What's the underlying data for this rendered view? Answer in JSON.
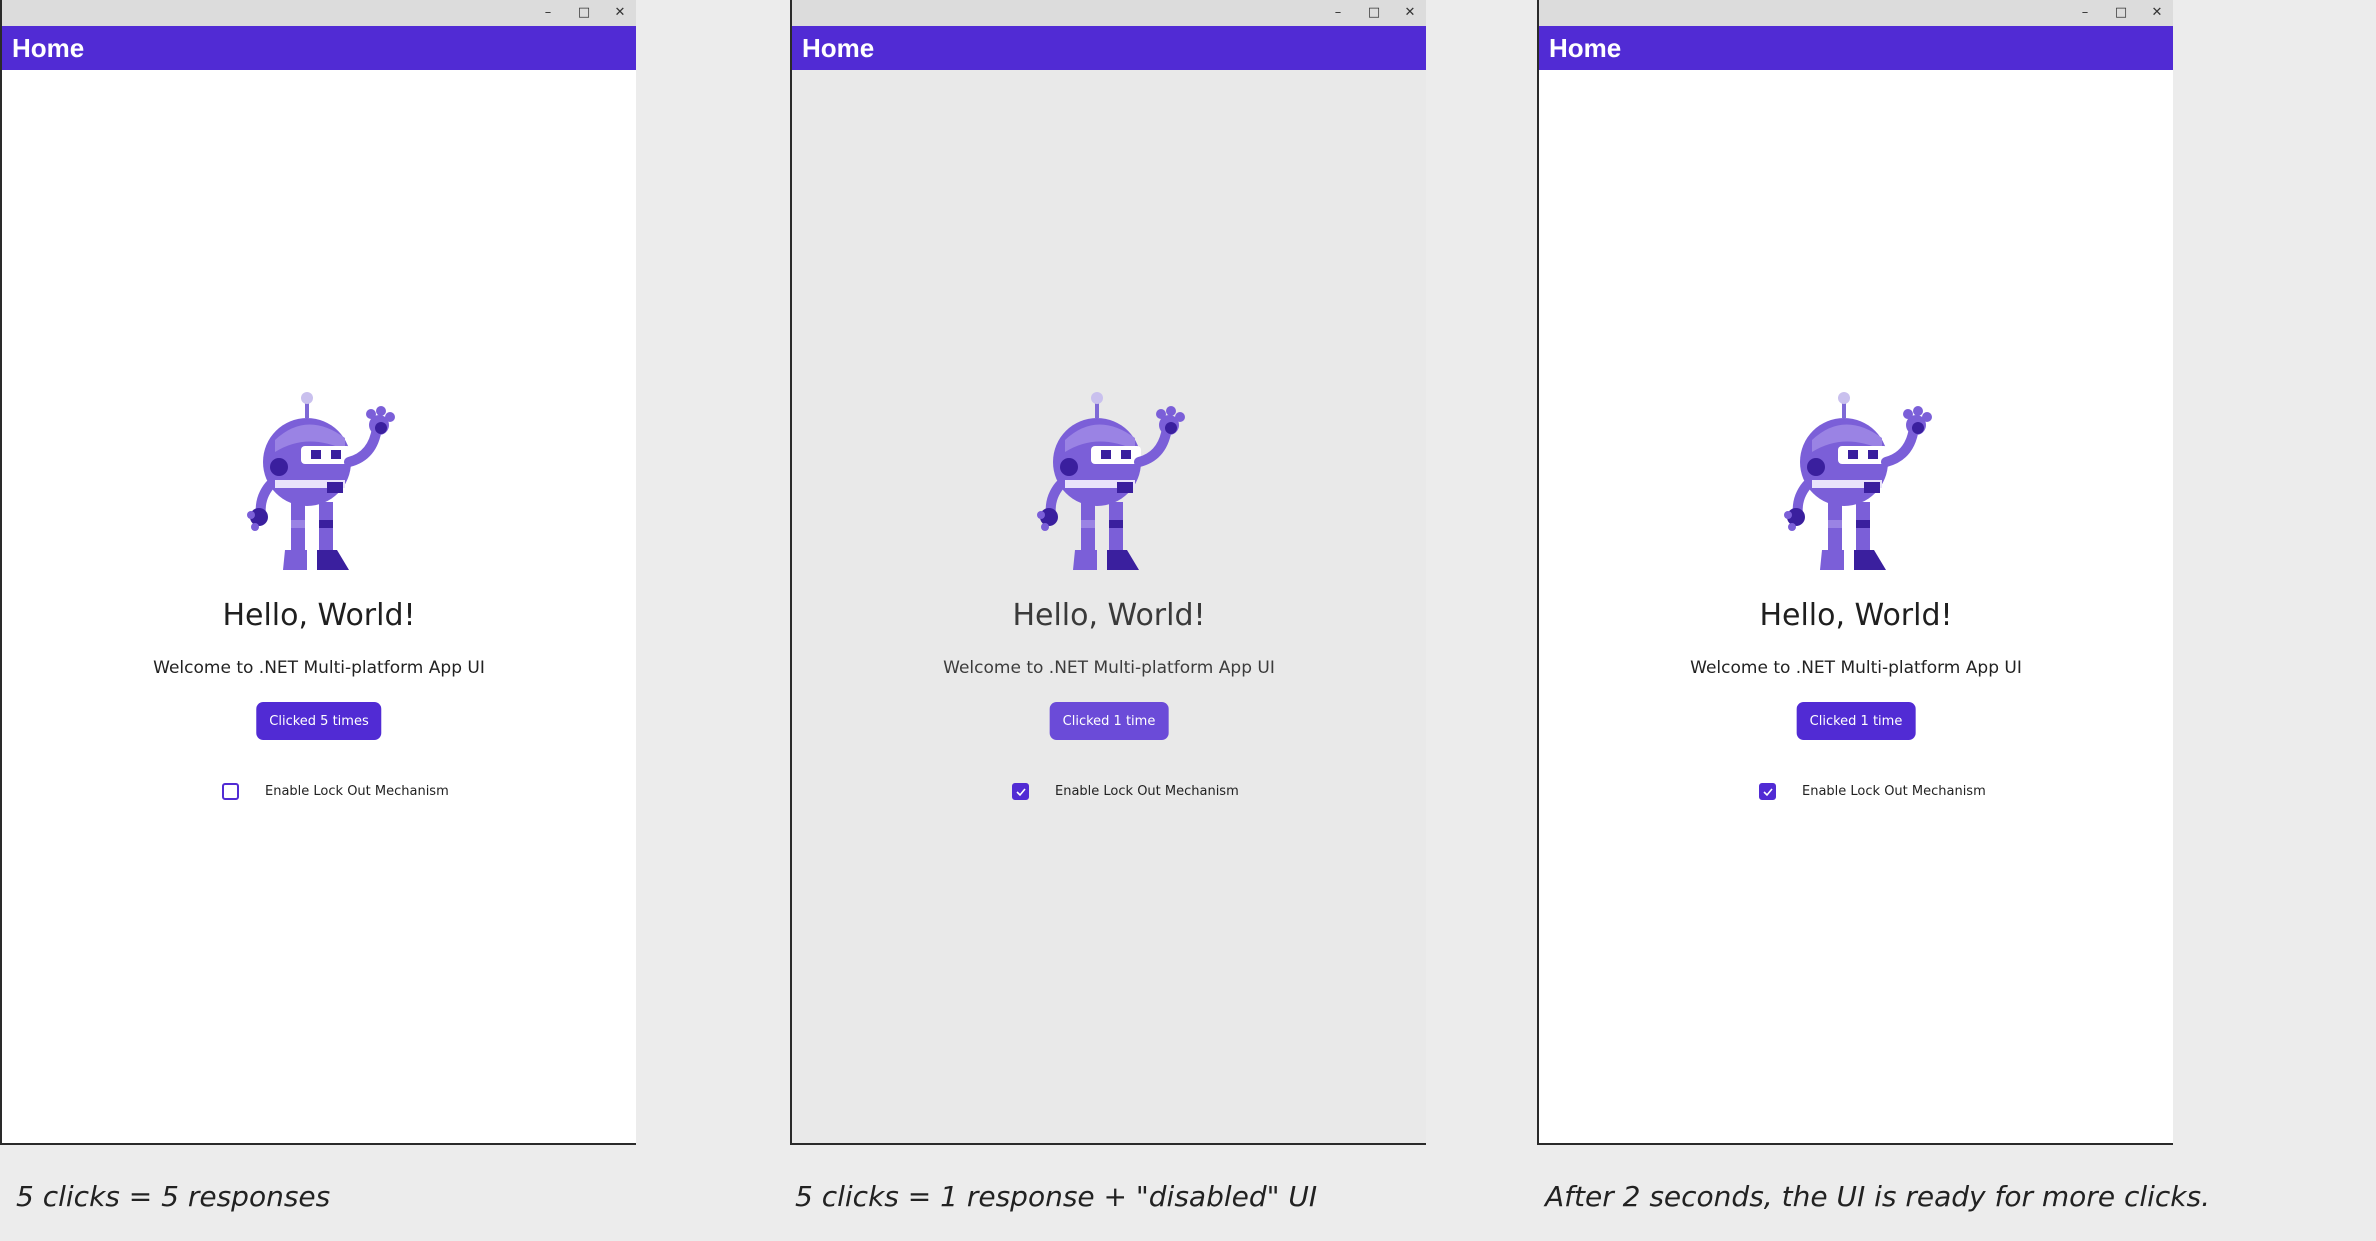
{
  "panels": [
    {
      "state": "normal",
      "app_title": "Home",
      "hello": "Hello, World!",
      "welcome": "Welcome to .NET Multi-platform App UI",
      "button_label": "Clicked 5 times",
      "lock_label": "Enable Lock Out Mechanism",
      "lock_checked": false,
      "caption": "5 clicks = 5 responses"
    },
    {
      "state": "disabled",
      "app_title": "Home",
      "hello": "Hello, World!",
      "welcome": "Welcome to .NET Multi-platform App UI",
      "button_label": "Clicked 1 time",
      "lock_label": "Enable Lock Out Mechanism",
      "lock_checked": true,
      "caption": "5 clicks = 1 response + \"disabled\" UI"
    },
    {
      "state": "normal",
      "app_title": "Home",
      "hello": "Hello, World!",
      "welcome": "Welcome to .NET Multi-platform App UI",
      "button_label": "Clicked 1 time",
      "lock_label": "Enable Lock Out Mechanism",
      "lock_checked": true,
      "caption": "After 2 seconds, the UI is ready for more clicks."
    }
  ],
  "window_controls": {
    "minimize": "–",
    "maximize": "□",
    "close": "✕"
  },
  "colors": {
    "accent": "#512bd4",
    "disabled_background": "#e9e9e9",
    "page_background": "#ececec"
  },
  "icons": {
    "mascot": "dotnet-bot-icon",
    "check": "checkmark-icon"
  }
}
